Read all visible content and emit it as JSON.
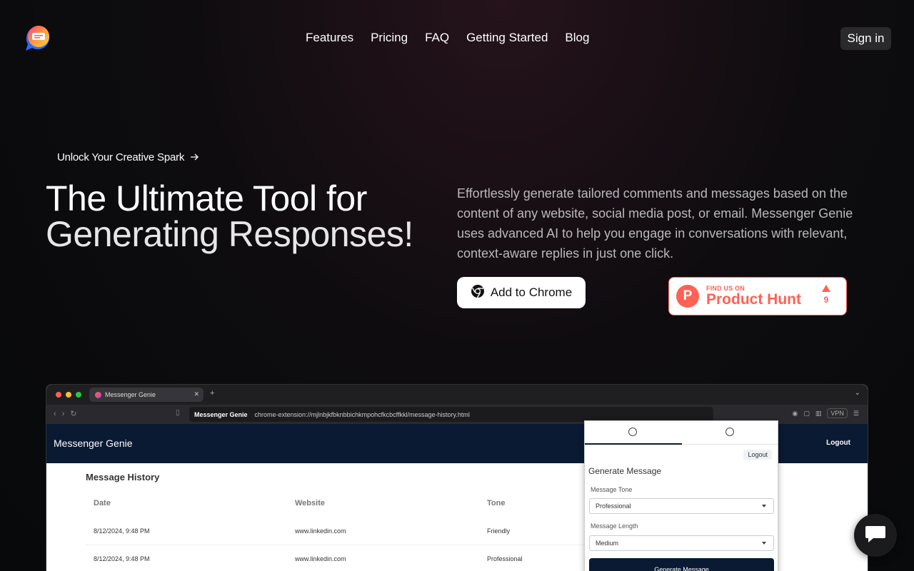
{
  "nav": {
    "links": [
      "Features",
      "Pricing",
      "FAQ",
      "Getting Started",
      "Blog"
    ],
    "signin": "Sign in"
  },
  "hero": {
    "eyebrow": "Unlock Your Creative Spark",
    "title_line1": "The Ultimate Tool for",
    "title_line2": "Generating Responses!",
    "description": "Effortlessly generate tailored comments and messages based on the content of any website, social media post, or email. Messenger Genie uses advanced AI to help you engage in conversations with relevant, context-aware replies in just one click.",
    "chrome_button": "Add to Chrome",
    "product_hunt": {
      "small": "FIND US ON",
      "big": "Product Hunt",
      "votes": "9"
    }
  },
  "browser": {
    "tab_title": "Messenger Genie",
    "url_label": "Messenger Genie",
    "url": "chrome-extension://mjlnbjkfbknbbichkmpohcfkcbcffkkl/message-history.html",
    "vpn": "VPN",
    "app_title": "Messenger Genie",
    "app_logout": "Logout",
    "history_title": "Message History",
    "columns": [
      "Date",
      "Website",
      "Tone"
    ],
    "rows": [
      [
        "8/12/2024, 9:48 PM",
        "www.linkedin.com",
        "Friendly"
      ],
      [
        "8/12/2024, 9:48 PM",
        "www.linkedin.com",
        "Professional"
      ]
    ]
  },
  "popup": {
    "logout": "Logout",
    "title": "Generate Message",
    "tone_label": "Message Tone",
    "tone_value": "Professional",
    "length_label": "Message Length",
    "length_value": "Medium",
    "generate": "Generate Message"
  },
  "colors": {
    "accent_ph": "#ff6154",
    "app_header": "#0b1a33"
  }
}
